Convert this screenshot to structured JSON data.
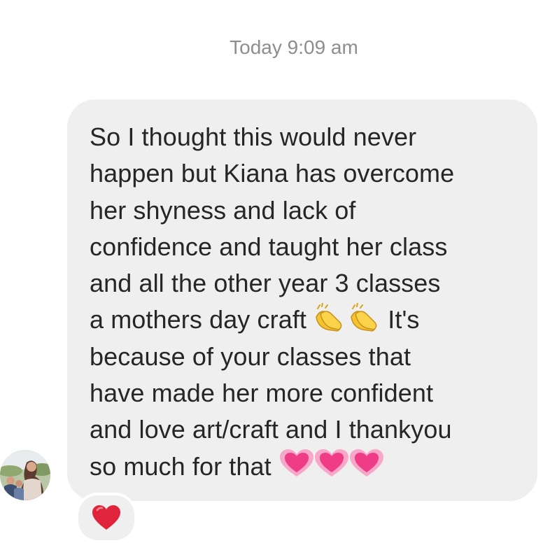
{
  "timestamp": "Today 9:09 am",
  "message": {
    "lines": [
      "So I thought this would never",
      "happen but Kiana has overcome",
      "her shyness and lack of",
      "confidence and taught her class",
      "and all the other year 3 classes",
      "a mothers day craft",
      "It's",
      "because of your classes that",
      "have made her more confident",
      "and love art/craft and I thankyou",
      "so much for that"
    ],
    "emojis": {
      "clap": "clapping-hands",
      "heart": "sparkling-pink-heart"
    }
  },
  "reaction": {
    "icon": "red-heart"
  },
  "colors": {
    "bubble": "#efefef",
    "text": "#262626",
    "timestamp": "#8e8e8e",
    "heart_red": "#e0243b",
    "heart_pink": "#f0428a"
  }
}
